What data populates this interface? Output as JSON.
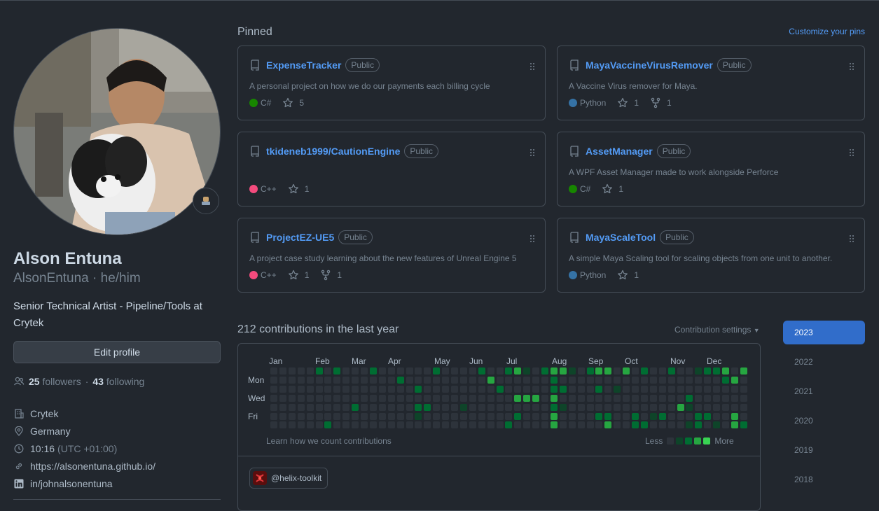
{
  "profile": {
    "full_name": "Alson Entuna",
    "login": "AlsonEntuna",
    "pronouns": "he/him",
    "bio": "Senior Technical Artist - Pipeline/Tools at Crytek",
    "edit_button": "Edit profile",
    "followers_count": "25",
    "followers_label": "followers",
    "following_count": "43",
    "following_label": "following",
    "company": "Crytek",
    "location": "Germany",
    "local_time": "10:16",
    "timezone": "(UTC +01:00)",
    "website": "https://alsonentuna.github.io/",
    "linkedin": "in/johnalsonentuna"
  },
  "pinned": {
    "title": "Pinned",
    "customize_link": "Customize your pins",
    "repos": [
      {
        "name": "ExpenseTracker",
        "visibility": "Public",
        "description": "A personal project on how we do our payments each billing cycle",
        "language": "C#",
        "language_color": "#178600",
        "stars": "5",
        "forks": ""
      },
      {
        "name": "MayaVaccineVirusRemover",
        "visibility": "Public",
        "description": "A Vaccine Virus remover for Maya.",
        "language": "Python",
        "language_color": "#3572A5",
        "stars": "1",
        "forks": "1"
      },
      {
        "name": "tkideneb1999/CautionEngine",
        "visibility": "Public",
        "description": "",
        "language": "C++",
        "language_color": "#f34b7d",
        "stars": "1",
        "forks": ""
      },
      {
        "name": "AssetManager",
        "visibility": "Public",
        "description": "A WPF Asset Manager made to work alongside Perforce",
        "language": "C#",
        "language_color": "#178600",
        "stars": "1",
        "forks": ""
      },
      {
        "name": "ProjectEZ-UE5",
        "visibility": "Public",
        "description": "A project case study learning about the new features of Unreal Engine 5",
        "language": "C++",
        "language_color": "#f34b7d",
        "stars": "1",
        "forks": "1"
      },
      {
        "name": "MayaScaleTool",
        "visibility": "Public",
        "description": "A simple Maya Scaling tool for scaling objects from one unit to another.",
        "language": "Python",
        "language_color": "#3572A5",
        "stars": "1",
        "forks": ""
      }
    ]
  },
  "contributions": {
    "title": "212 contributions in the last year",
    "settings_label": "Contribution settings",
    "months": [
      "Jan",
      "Feb",
      "Mar",
      "Apr",
      "May",
      "Jun",
      "Jul",
      "Aug",
      "Sep",
      "Oct",
      "Nov",
      "Dec"
    ],
    "days": [
      "Mon",
      "Wed",
      "Fri"
    ],
    "learn_link": "Learn how we count contributions",
    "legend_less": "Less",
    "legend_more": "More",
    "level_colors": [
      "#2d333b",
      "#0e4429",
      "#006d32",
      "#26a641",
      "#39d353"
    ],
    "weeks": 53,
    "active_cells": [
      [
        6,
        0,
        2
      ],
      [
        7,
        6,
        2
      ],
      [
        8,
        0,
        2
      ],
      [
        10,
        4,
        2
      ],
      [
        12,
        0,
        2
      ],
      [
        15,
        1,
        2
      ],
      [
        17,
        4,
        2
      ],
      [
        17,
        2,
        2
      ],
      [
        18,
        5,
        1
      ],
      [
        19,
        4,
        2
      ],
      [
        20,
        0,
        2
      ],
      [
        23,
        4,
        1
      ],
      [
        25,
        0,
        2
      ],
      [
        26,
        1,
        3
      ],
      [
        27,
        2,
        2
      ],
      [
        29,
        6,
        2
      ],
      [
        29,
        0,
        2
      ],
      [
        30,
        0,
        3
      ],
      [
        30,
        3,
        3
      ],
      [
        30,
        5,
        2
      ],
      [
        31,
        3,
        3
      ],
      [
        33,
        0,
        2
      ],
      [
        34,
        0,
        3
      ],
      [
        34,
        1,
        2
      ],
      [
        34,
        2,
        2
      ],
      [
        34,
        3,
        3
      ],
      [
        34,
        4,
        2
      ],
      [
        34,
        5,
        3
      ],
      [
        34,
        6,
        3
      ],
      [
        35,
        0,
        3
      ],
      [
        35,
        2,
        2
      ],
      [
        35,
        4,
        1
      ],
      [
        36,
        0,
        1
      ],
      [
        38,
        0,
        2
      ],
      [
        39,
        2,
        2
      ],
      [
        39,
        5,
        2
      ],
      [
        40,
        0,
        3
      ],
      [
        41,
        6,
        3
      ],
      [
        42,
        2,
        1
      ],
      [
        43,
        0,
        3
      ],
      [
        44,
        5,
        2
      ],
      [
        44,
        6,
        2
      ],
      [
        45,
        0,
        2
      ],
      [
        46,
        5,
        1
      ],
      [
        48,
        0,
        2
      ],
      [
        49,
        4,
        3
      ],
      [
        50,
        3,
        2
      ],
      [
        50,
        4,
        1
      ],
      [
        52,
        0,
        1
      ],
      [
        52,
        5,
        1
      ],
      [
        52,
        6,
        2
      ],
      [
        53,
        0,
        2
      ],
      [
        53,
        5,
        2
      ],
      [
        54,
        0,
        2
      ],
      [
        54,
        6,
        1
      ],
      [
        55,
        1,
        2
      ],
      [
        55,
        0,
        3
      ],
      [
        56,
        1,
        3
      ],
      [
        56,
        5,
        3
      ],
      [
        56,
        6,
        3
      ],
      [
        57,
        0,
        3
      ],
      [
        57,
        6,
        2
      ],
      [
        51,
        5,
        2
      ],
      [
        50,
        6,
        1
      ],
      [
        47,
        5,
        2
      ],
      [
        45,
        6,
        2
      ],
      [
        44,
        6,
        2
      ],
      [
        31,
        0,
        1
      ],
      [
        32,
        3,
        3
      ],
      [
        41,
        0,
        3
      ],
      [
        41,
        5,
        2
      ]
    ],
    "org_handle": "@helix-toolkit"
  },
  "years": [
    "2023",
    "2022",
    "2021",
    "2020",
    "2019",
    "2018"
  ],
  "active_year": "2023"
}
